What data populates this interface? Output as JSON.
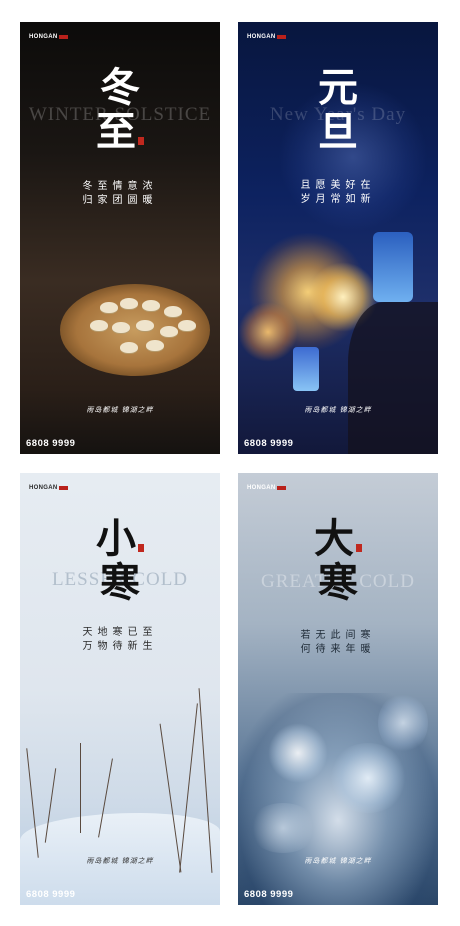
{
  "posters": [
    {
      "id": "winter-solstice",
      "logo": "HONGAN",
      "english_ghost": "WINTER SOLSTICE",
      "title_chars": [
        "冬",
        "至"
      ],
      "verse_lines": [
        "冬至情意浓",
        "归家团圆暖"
      ],
      "slogan": "雨岛都城 锦湖之畔",
      "phone": "6808 9999"
    },
    {
      "id": "new-year",
      "logo": "HONGAN",
      "english_ghost": "New Year's Day",
      "title_chars": [
        "元",
        "旦"
      ],
      "verse_lines": [
        "且愿美好在",
        "岁月常如新"
      ],
      "slogan": "雨岛都城 锦湖之畔",
      "phone": "6808 9999"
    },
    {
      "id": "lesser-cold",
      "logo": "HONGAN",
      "english_ghost": "LESSER COLD",
      "title_chars": [
        "小",
        "寒"
      ],
      "verse_lines": [
        "天地寒已至",
        "万物待新生"
      ],
      "slogan": "雨岛都城 锦湖之畔",
      "phone": "6808 9999"
    },
    {
      "id": "greater-cold",
      "logo": "HONGAN",
      "english_ghost": "GREATER COLD",
      "title_chars": [
        "大",
        "寒"
      ],
      "verse_lines": [
        "若无此间寒",
        "何待来年暖"
      ],
      "slogan": "雨岛都城 锦湖之畔",
      "phone": "6808 9999"
    }
  ],
  "colors": {
    "seal_red": "#c0281e",
    "logo_red": "#b9211b"
  }
}
